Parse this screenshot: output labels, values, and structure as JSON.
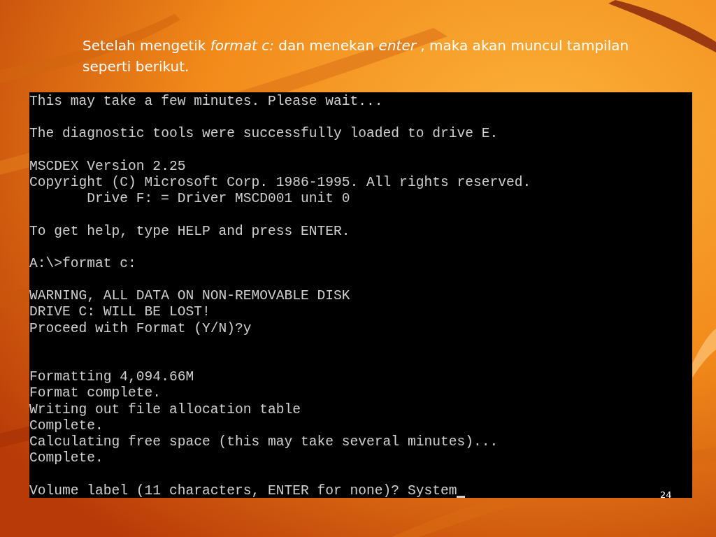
{
  "slide": {
    "caption": "Setelah mengetik *format c:* dan menekan *enter* , maka akan muncul tampilan seperti berikut.",
    "terminal": {
      "cursor": true,
      "lines": [
        {
          "kind": "text",
          "text": "This may take a few minutes. Please wait..."
        },
        {
          "kind": "blank"
        },
        {
          "kind": "text",
          "text": "The diagnostic tools were successfully loaded to drive E."
        },
        {
          "kind": "blank"
        },
        {
          "kind": "text",
          "text": "MSCDEX Version 2.25"
        },
        {
          "kind": "text",
          "text": "Copyright (C) Microsoft Corp. 1986-1995. All rights reserved."
        },
        {
          "kind": "indented",
          "text": "Drive F: = Driver MSCD001 unit 0"
        },
        {
          "kind": "blank"
        },
        {
          "kind": "text",
          "text": "To get help, type HELP and press ENTER."
        },
        {
          "kind": "blank"
        },
        {
          "kind": "text",
          "text": "A:\\>format c:"
        },
        {
          "kind": "blank"
        },
        {
          "kind": "text",
          "text": "WARNING, ALL DATA ON NON-REMOVABLE DISK"
        },
        {
          "kind": "text",
          "text": "DRIVE C: WILL BE LOST!"
        },
        {
          "kind": "text",
          "text": "Proceed with Format (Y/N)?y"
        },
        {
          "kind": "blank"
        },
        {
          "kind": "blank"
        },
        {
          "kind": "text",
          "text": "Formatting 4,094.66M"
        },
        {
          "kind": "text",
          "text": "Format complete."
        },
        {
          "kind": "text",
          "text": "Writing out file allocation table"
        },
        {
          "kind": "text",
          "text": "Complete."
        },
        {
          "kind": "text",
          "text": "Calculating free space (this may take several minutes)..."
        },
        {
          "kind": "text",
          "text": "Complete."
        },
        {
          "kind": "blank"
        },
        {
          "kind": "text",
          "text": "Volume label (11 characters, ENTER for none)? System"
        }
      ]
    },
    "page_number": "24"
  }
}
